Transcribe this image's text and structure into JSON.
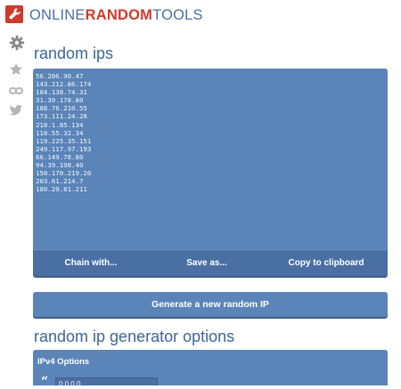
{
  "header": {
    "brand_part1": "ONLINE",
    "brand_part2": "RANDOM",
    "brand_part3": "TOOLS",
    "logo_icon": "wrench-icon"
  },
  "rail": {
    "icons": [
      "gear-icon",
      "star-icon",
      "link-icon",
      "twitter-bird-icon"
    ]
  },
  "output": {
    "title": "random ips",
    "text": "56.206.90.47\n143.212.86.174\n184.138.74.31\n31.39.178.80\n188.76.210.55\n173.111.24.28\n210.1.85.134\n110.55.32.34\n119.225.35.151\n249.117.97.193\n66.149.78.80\n94.39.198.40\n150.170.219.20\n203.61.214.7\n180.20.81.211",
    "chain_label": "Chain with...",
    "save_label": "Save as...",
    "copy_label": "Copy to clipboard"
  },
  "generate": {
    "label": "Generate a new random IP"
  },
  "options": {
    "title": "random ip generator options",
    "ipv4_heading": "IPv4 Options",
    "range_start_value": "0.0.0.0"
  },
  "colors": {
    "brand_blue": "#4a6fa5",
    "brand_red": "#d0392b",
    "panel_blue": "#5b84b8",
    "bar_blue": "#4a6fa3"
  }
}
